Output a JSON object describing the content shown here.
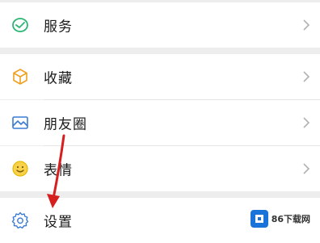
{
  "menu": {
    "items": [
      {
        "label": "服务",
        "icon": "service-icon"
      },
      {
        "label": "收藏",
        "icon": "favorites-cube-icon"
      },
      {
        "label": "朋友圈",
        "icon": "moments-image-icon"
      },
      {
        "label": "表情",
        "icon": "sticker-smile-icon"
      },
      {
        "label": "设置",
        "icon": "settings-gear-icon"
      }
    ]
  },
  "watermark": {
    "text": "86下载网",
    "brand_color": "#1a73d8"
  },
  "colors": {
    "accent_green": "#2bb673",
    "annotation_arrow": "#d62020",
    "chevron": "#b2b2b2"
  }
}
